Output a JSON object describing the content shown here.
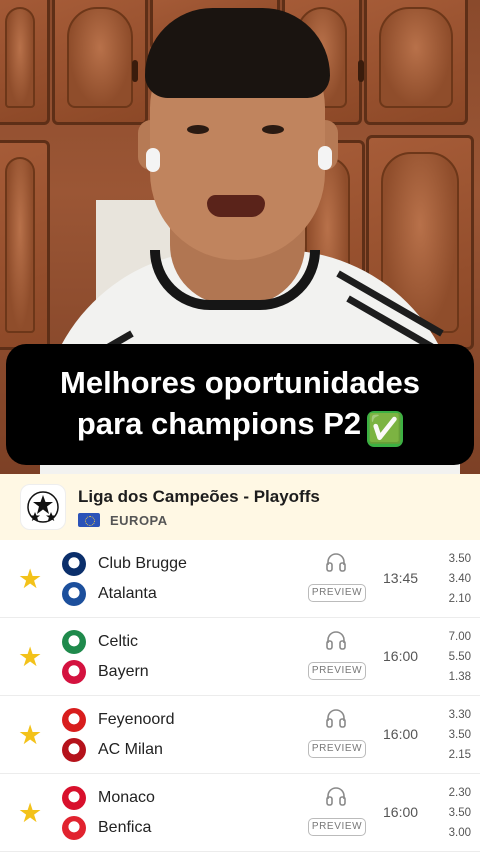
{
  "caption": {
    "line1": "Melhores oportunidades",
    "line2": "para champions P2",
    "emoji": "✅"
  },
  "league": {
    "name": "Liga dos Campeões - Playoffs",
    "region": "EUROPA",
    "logo_icon": "champions-league-starball-icon"
  },
  "preview_label": "PREVIEW",
  "matches": [
    {
      "home": "Club Brugge",
      "away": "Atalanta",
      "time": "13:45",
      "odds": [
        "3.50",
        "3.40",
        "2.10"
      ],
      "home_color": "#0b2f6b",
      "away_color": "#1c4f9c"
    },
    {
      "home": "Celtic",
      "away": "Bayern",
      "time": "16:00",
      "odds": [
        "7.00",
        "5.50",
        "1.38"
      ],
      "home_color": "#1f8a4c",
      "away_color": "#d4123f"
    },
    {
      "home": "Feyenoord",
      "away": "AC Milan",
      "time": "16:00",
      "odds": [
        "3.30",
        "3.50",
        "2.15"
      ],
      "home_color": "#d81d1d",
      "away_color": "#b5121b"
    },
    {
      "home": "Monaco",
      "away": "Benfica",
      "time": "16:00",
      "odds": [
        "2.30",
        "3.50",
        "3.00"
      ],
      "home_color": "#d8102c",
      "away_color": "#e1232f"
    }
  ],
  "colors": {
    "favorite_star": "#f3c21a",
    "league_header_bg": "#fff8e4"
  }
}
